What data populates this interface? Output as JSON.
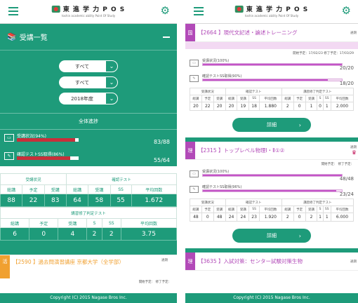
{
  "left": {
    "header": {
      "logo_text": "東 進 学 力 P O S",
      "logo_sub": "toshin academic ability Point Of Study"
    },
    "section_title": "受講一覧",
    "filters": [
      "すべて",
      "すべて",
      "2018年度"
    ],
    "overall_title": "全体進捗",
    "progress": [
      {
        "label": "受講状況(94%)",
        "value": "83/88",
        "percent": 94
      },
      {
        "label": "確認テストSS取得(86%)",
        "value": "55/64",
        "percent": 86
      }
    ],
    "table1": {
      "group_headers": [
        "受講状況",
        "確認テスト"
      ],
      "headers": [
        "総講",
        "予定",
        "受講",
        "総講",
        "受講",
        "SS",
        "平均回数"
      ],
      "values": [
        "88",
        "22",
        "83",
        "64",
        "58",
        "55",
        "1.672"
      ]
    },
    "table2": {
      "caption": "講習修了判定テスト",
      "headers": [
        "総講",
        "予定",
        "受講",
        "S",
        "SS",
        "平均回数"
      ],
      "values": [
        "6",
        "0",
        "4",
        "2",
        "2",
        "3.75"
      ]
    },
    "course": {
      "tag": "活",
      "name": "【2590 】過去問演習講座 京都大学（全学部）",
      "side": "通期",
      "dates": "開始予定： 修了予定："
    },
    "footer": "Copyright (C) 2015 Nagase Bros Inc."
  },
  "right": {
    "cards": [
      {
        "tag": "国",
        "tag_color": "#b24ab8",
        "title": "【2664 】現代文記述・論述トレーニング",
        "side": "通期",
        "dates": "開始予定：17/02/23 修了予定：17/03/29",
        "progress": [
          {
            "label": "受講状況(100%)",
            "value": "20/20",
            "percent": 100
          },
          {
            "label": "確認テストSS取得(90%)",
            "value": "18/20",
            "percent": 90
          }
        ],
        "group_headers": [
          "受講状況",
          "確認テスト",
          "講習修了判定テスト"
        ],
        "headers": [
          "総講",
          "予定",
          "受講",
          "総講",
          "受講",
          "SS",
          "平均回数",
          "総講",
          "予定",
          "受講",
          "S",
          "SS",
          "平均回数"
        ],
        "values": [
          "20",
          "22",
          "20",
          "20",
          "19",
          "18",
          "1.880",
          "2",
          "0",
          "1",
          "0",
          "1",
          "2.000"
        ],
        "button": "詳細"
      },
      {
        "tag": "理",
        "tag_color": "#b24ab8",
        "title": "【2315 】トップレベル物理Ⅰ・Ⅱ①②",
        "side": "通期",
        "dates": "開始予定： 修了予定：",
        "progress": [
          {
            "label": "受講状況(100%)",
            "value": "48/48",
            "percent": 100
          },
          {
            "label": "確認テストSS取得(96%)",
            "value": "23/24",
            "percent": 96
          }
        ],
        "group_headers": [
          "受講状況",
          "確認テスト",
          "講習修了判定テスト"
        ],
        "headers": [
          "総講",
          "予定",
          "受講",
          "総講",
          "受講",
          "SS",
          "平均回数",
          "総講",
          "予定",
          "受講",
          "S",
          "SS",
          "平均回数"
        ],
        "values": [
          "48",
          "0",
          "48",
          "24",
          "24",
          "23",
          "1.920",
          "2",
          "0",
          "2",
          "1",
          "1",
          "6.000"
        ],
        "button": "詳細"
      }
    ],
    "third": {
      "tag": "理",
      "title": "【3635 】入試対策：センター試験対策生物",
      "side": "通期"
    },
    "footer": "Copyright (C) 2015 Nagase Bros Inc."
  }
}
